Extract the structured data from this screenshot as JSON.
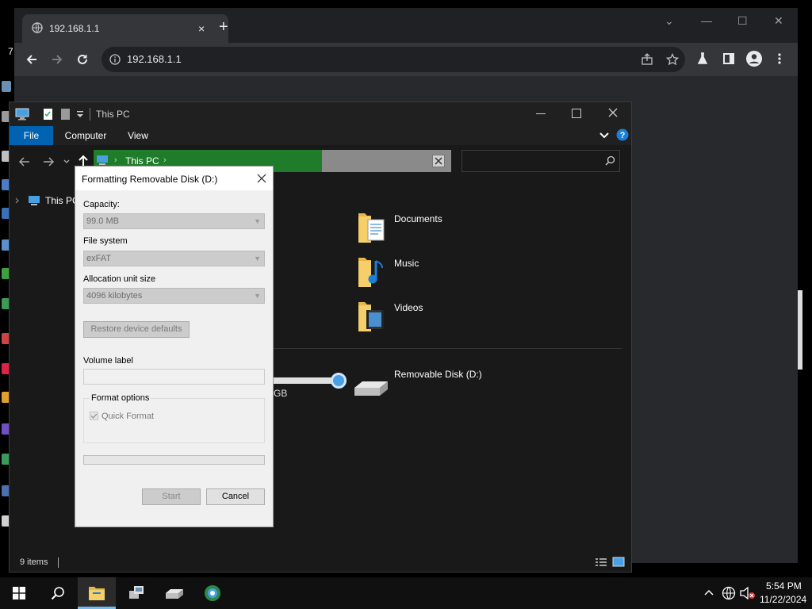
{
  "browser": {
    "tab_title": "192.168.1.1",
    "tab_close": "×",
    "new_tab": "+",
    "url": "192.168.1.1",
    "window_controls": [
      "⌄",
      "—",
      "☐",
      "✕"
    ]
  },
  "desktop": {
    "partial_text": "7"
  },
  "explorer": {
    "title": "This PC",
    "ribbon_tabs": {
      "file": "File",
      "computer": "Computer",
      "view": "View"
    },
    "address_path": "This PC",
    "nav_item": "This PC",
    "folders": [
      {
        "name": "Documents",
        "icon": "documents-folder-icon"
      },
      {
        "name": "Music",
        "icon": "music-folder-icon"
      },
      {
        "name": "Videos",
        "icon": "videos-folder-icon"
      }
    ],
    "drive": {
      "name": "Removable Disk (D:)",
      "size_fragment": "GB",
      "icon": "removable-disk-icon"
    },
    "status_items": "9 items",
    "accent_color": "#0063b1",
    "address_selection_color": "#1e7c2a"
  },
  "format_dialog": {
    "title": "Formatting Removable Disk (D:)",
    "capacity_label": "Capacity:",
    "capacity_value": "99.0 MB",
    "fs_label": "File system",
    "fs_value": "exFAT",
    "alloc_label": "Allocation unit size",
    "alloc_value": "4096 kilobytes",
    "restore_button": "Restore device defaults",
    "volume_label": "Volume label",
    "volume_value": "",
    "format_options_label": "Format options",
    "quick_format_label": "Quick Format",
    "quick_format_checked": true,
    "progress": 0,
    "start_button": "Start",
    "cancel_button": "Cancel"
  },
  "taskbar": {
    "time": "5:54 PM",
    "date": "11/22/2024",
    "pinned": [
      "start-icon",
      "search-icon",
      "file-explorer-icon",
      "network-app-icon",
      "drive-app-icon",
      "web-app-icon"
    ]
  }
}
